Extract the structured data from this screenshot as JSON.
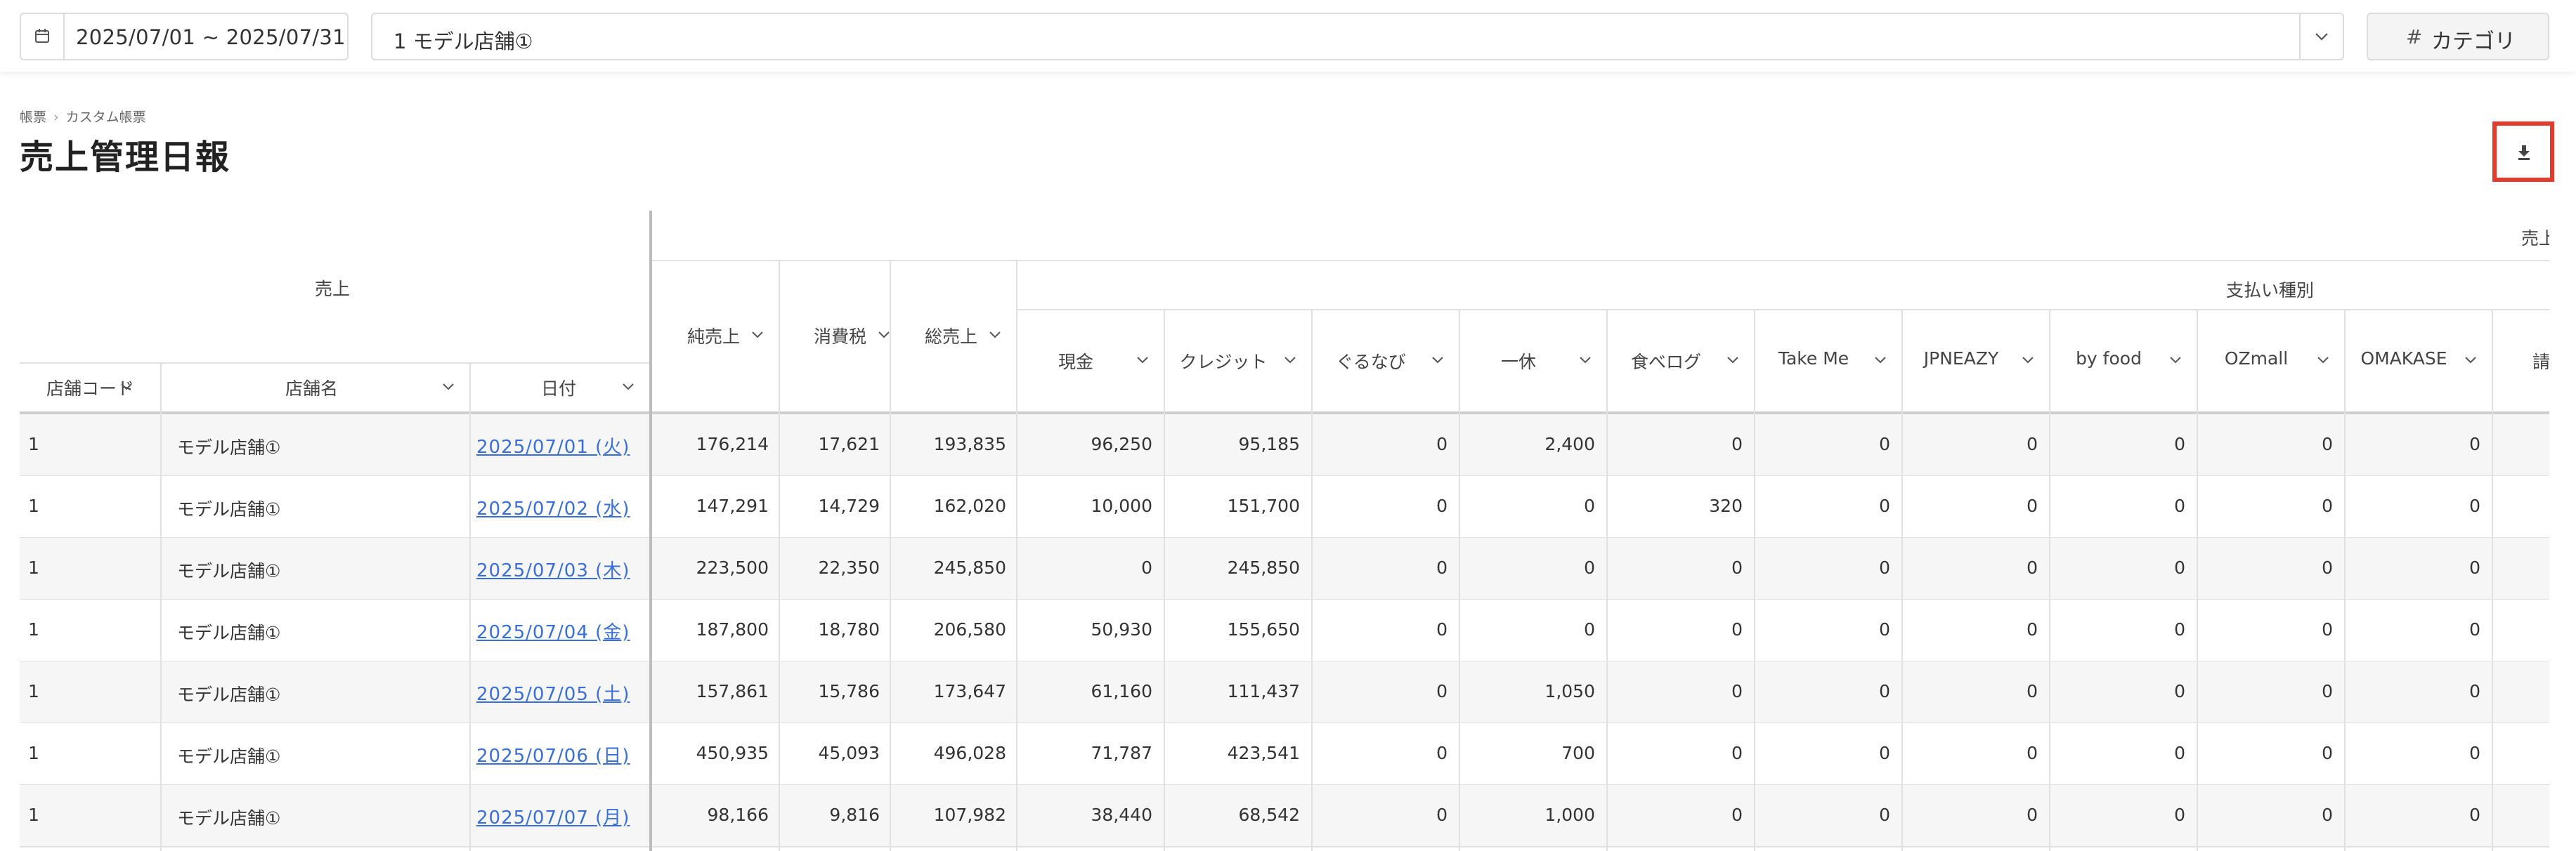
{
  "filters": {
    "date_range": "2025/07/01 ~ 2025/07/31",
    "store": "1 モデル店舗①",
    "category_button": "カテゴリ",
    "calendar_icon": "calendar-icon",
    "dropdown_icon": "chevron-down-icon"
  },
  "breadcrumb": {
    "root": "帳票",
    "current": "カスタム帳票"
  },
  "page_title": "売上管理日報",
  "download_icon": "download-icon",
  "table": {
    "group_left": "売上",
    "group_right_partial": "売上",
    "payment_group": "支払い種別",
    "fixed_columns": [
      "店舗コード",
      "店舗名",
      "日付"
    ],
    "sales_columns": [
      "純売上",
      "消費税",
      "総売上"
    ],
    "payment_columns": [
      "現金",
      "クレジット",
      "ぐるなび",
      "一休",
      "食べログ",
      "Take Me",
      "JPNEAZY",
      "by food",
      "OZmall",
      "OMAKASE",
      "請"
    ],
    "rows": [
      {
        "code": "1",
        "store": "モデル店舗①",
        "date": "2025/07/01 (火)",
        "values": [
          "176,214",
          "17,621",
          "193,835",
          "96,250",
          "95,185",
          "0",
          "2,400",
          "0",
          "0",
          "0",
          "0",
          "0",
          "0"
        ]
      },
      {
        "code": "1",
        "store": "モデル店舗①",
        "date": "2025/07/02 (水)",
        "values": [
          "147,291",
          "14,729",
          "162,020",
          "10,000",
          "151,700",
          "0",
          "0",
          "320",
          "0",
          "0",
          "0",
          "0",
          "0"
        ]
      },
      {
        "code": "1",
        "store": "モデル店舗①",
        "date": "2025/07/03 (木)",
        "values": [
          "223,500",
          "22,350",
          "245,850",
          "0",
          "245,850",
          "0",
          "0",
          "0",
          "0",
          "0",
          "0",
          "0",
          "0"
        ]
      },
      {
        "code": "1",
        "store": "モデル店舗①",
        "date": "2025/07/04 (金)",
        "values": [
          "187,800",
          "18,780",
          "206,580",
          "50,930",
          "155,650",
          "0",
          "0",
          "0",
          "0",
          "0",
          "0",
          "0",
          "0"
        ]
      },
      {
        "code": "1",
        "store": "モデル店舗①",
        "date": "2025/07/05 (土)",
        "values": [
          "157,861",
          "15,786",
          "173,647",
          "61,160",
          "111,437",
          "0",
          "1,050",
          "0",
          "0",
          "0",
          "0",
          "0",
          "0"
        ]
      },
      {
        "code": "1",
        "store": "モデル店舗①",
        "date": "2025/07/06 (日)",
        "values": [
          "450,935",
          "45,093",
          "496,028",
          "71,787",
          "423,541",
          "0",
          "700",
          "0",
          "0",
          "0",
          "0",
          "0",
          "0"
        ]
      },
      {
        "code": "1",
        "store": "モデル店舗①",
        "date": "2025/07/07 (月)",
        "values": [
          "98,166",
          "9,816",
          "107,982",
          "38,440",
          "68,542",
          "0",
          "1,000",
          "0",
          "0",
          "0",
          "0",
          "0",
          "0"
        ]
      }
    ]
  },
  "colors": {
    "link": "#3a6fd8",
    "highlight": "#e23c2f",
    "row_alt": "#f6f6f6",
    "border": "#e1e1e1"
  }
}
